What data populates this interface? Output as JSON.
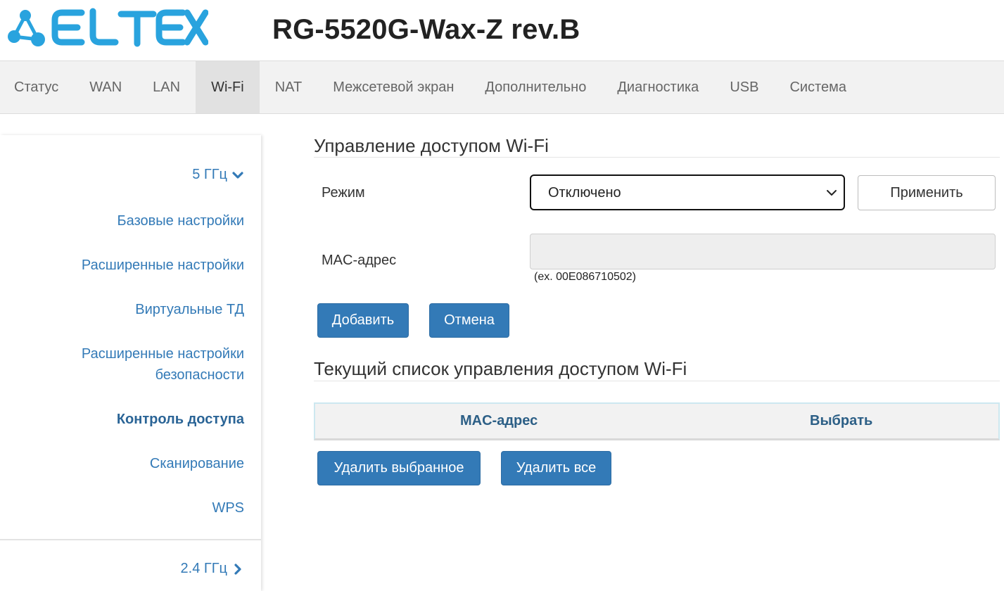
{
  "header": {
    "brand": "ELTEX",
    "model": "RG-5520G-Wax-Z rev.B",
    "brand_color": "#29a3de"
  },
  "nav": {
    "items": [
      {
        "label": "Статус"
      },
      {
        "label": "WAN"
      },
      {
        "label": "LAN"
      },
      {
        "label": "Wi-Fi",
        "active": true
      },
      {
        "label": "NAT"
      },
      {
        "label": "Межсетевой экран"
      },
      {
        "label": "Дополнительно"
      },
      {
        "label": "Диагностика"
      },
      {
        "label": "USB"
      },
      {
        "label": "Система"
      }
    ]
  },
  "sidebar": {
    "group_5ghz": {
      "label": "5 ГГц",
      "icon": "chevron-down-icon"
    },
    "items": [
      {
        "label": "Базовые настройки"
      },
      {
        "label": "Расширенные настройки"
      },
      {
        "label": "Виртуальные ТД"
      },
      {
        "label": "Расширенные настройки безопасности"
      },
      {
        "label": "Контроль доступа",
        "active": true
      },
      {
        "label": "Сканирование"
      },
      {
        "label": "WPS"
      }
    ],
    "group_24ghz": {
      "label": "2.4 ГГц",
      "icon": "chevron-right-icon"
    }
  },
  "access_control": {
    "title": "Управление доступом Wi-Fi",
    "mode_label": "Режим",
    "mode_value": "Отключено",
    "apply_label": "Применить",
    "mac_label": "MAC-адрес",
    "mac_value": "",
    "mac_hint": "(ex. 00E086710502)",
    "add_label": "Добавить",
    "cancel_label": "Отмена"
  },
  "current_list": {
    "title": "Текущий список управления доступом Wi-Fi",
    "columns": [
      "MAC-адрес",
      "Выбрать"
    ],
    "rows": [],
    "delete_selected_label": "Удалить выбранное",
    "delete_all_label": "Удалить все"
  },
  "colors": {
    "primary": "#337ab7",
    "link": "#337ab7",
    "nav_bg": "#f2f2f2",
    "nav_active": "#e1e1e1"
  }
}
